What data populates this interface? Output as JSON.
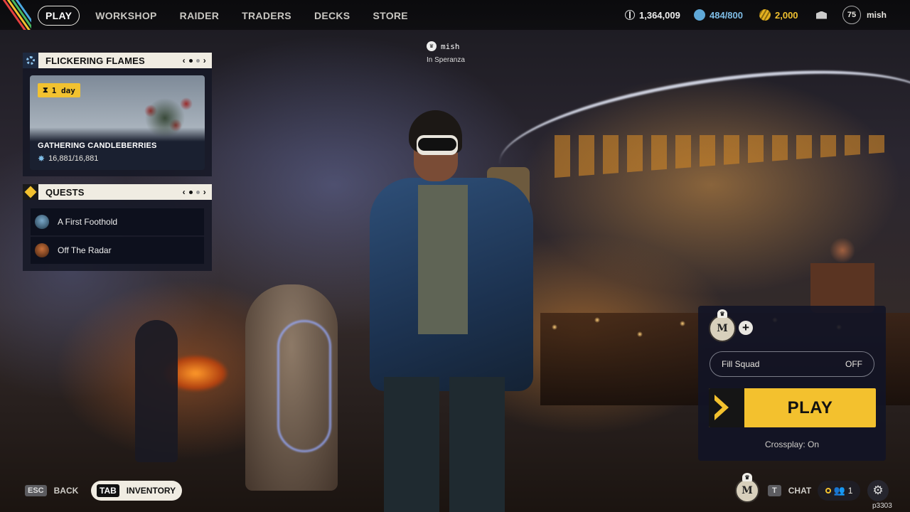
{
  "nav": {
    "items": [
      {
        "label": "PLAY",
        "active": true
      },
      {
        "label": "WORKSHOP",
        "active": false
      },
      {
        "label": "RAIDER",
        "active": false
      },
      {
        "label": "TRADERS",
        "active": false
      },
      {
        "label": "DECKS",
        "active": false
      },
      {
        "label": "STORE",
        "active": false
      }
    ]
  },
  "currencies": {
    "coins": "1,364,009",
    "stash": "484/800",
    "credits": "2,000"
  },
  "player": {
    "level": "75",
    "name": "mish"
  },
  "player_tag": {
    "name": "mish",
    "location": "In Speranza"
  },
  "event_panel": {
    "title": "FLICKERING FLAMES",
    "timer": "1 day",
    "card_title": "GATHERING CANDLEBERRIES",
    "progress": "16,881/16,881",
    "page": 2,
    "pages": 3
  },
  "quests_panel": {
    "title": "QUESTS",
    "page": 2,
    "pages": 3,
    "items": [
      {
        "label": "A First Foothold"
      },
      {
        "label": "Off The Radar"
      }
    ]
  },
  "play_panel": {
    "avatar_letter": "M",
    "fill_squad_label": "Fill Squad",
    "fill_squad_value": "OFF",
    "play_label": "PLAY",
    "crossplay": "Crossplay: On"
  },
  "bottom": {
    "back_key": "ESC",
    "back_label": "BACK",
    "inventory_key": "TAB",
    "inventory_label": "INVENTORY",
    "chat_key": "T",
    "chat_label": "CHAT",
    "squad_count": "1",
    "build": "p3303"
  },
  "colors": {
    "accent_yellow": "#f3c12e",
    "panel_header": "#f0ece2",
    "panel_bg": "#16182a",
    "stash_blue": "#5fa8d8",
    "credit_gold": "#e3b020"
  },
  "icons": {
    "coins": "coin-stack-icon",
    "stash": "stash-icon",
    "credits": "credits-icon",
    "mail": "mail-icon",
    "crown": "crown-icon",
    "event": "gear-flame-icon",
    "quests": "quest-diamond-icon",
    "timer": "hourglass-icon",
    "squad": "people-icon",
    "settings": "gear-icon"
  }
}
